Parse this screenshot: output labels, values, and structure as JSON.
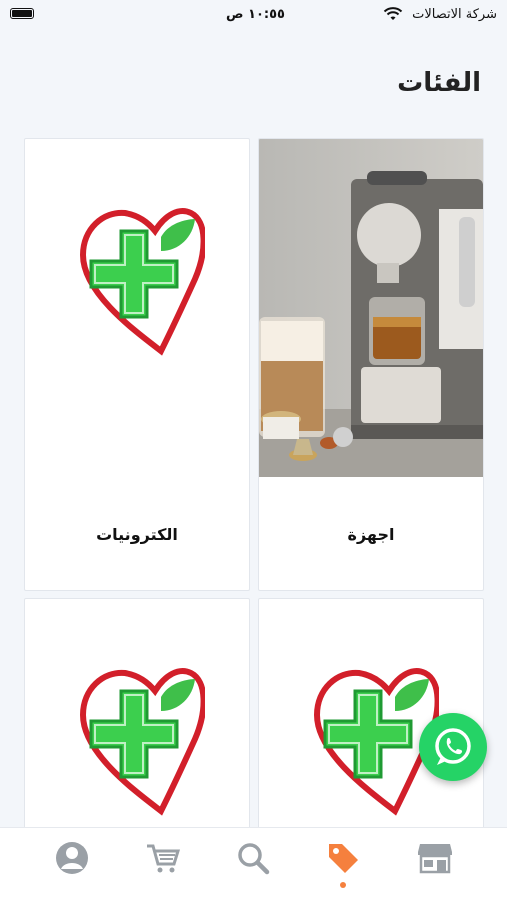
{
  "status_bar": {
    "time": "١٠:٥٥ ص",
    "carrier": "شركة الاتصالات"
  },
  "page": {
    "title": "الفئات"
  },
  "categories": [
    {
      "label": "اجهزة",
      "image": "coffee-machine-photo"
    },
    {
      "label": "الكترونيات",
      "image": "pharmacy-logo"
    },
    {
      "label": "",
      "image": "pharmacy-logo"
    },
    {
      "label": "",
      "image": "pharmacy-logo"
    }
  ],
  "tabbar": {
    "items": [
      "store-icon",
      "tag-icon",
      "search-icon",
      "cart-icon",
      "profile-icon"
    ],
    "active": "tag-icon",
    "active_color": "#f5803e",
    "inactive_color": "#9aa0a6"
  },
  "fab": {
    "icon": "whatsapp-icon",
    "color": "#25d366"
  }
}
